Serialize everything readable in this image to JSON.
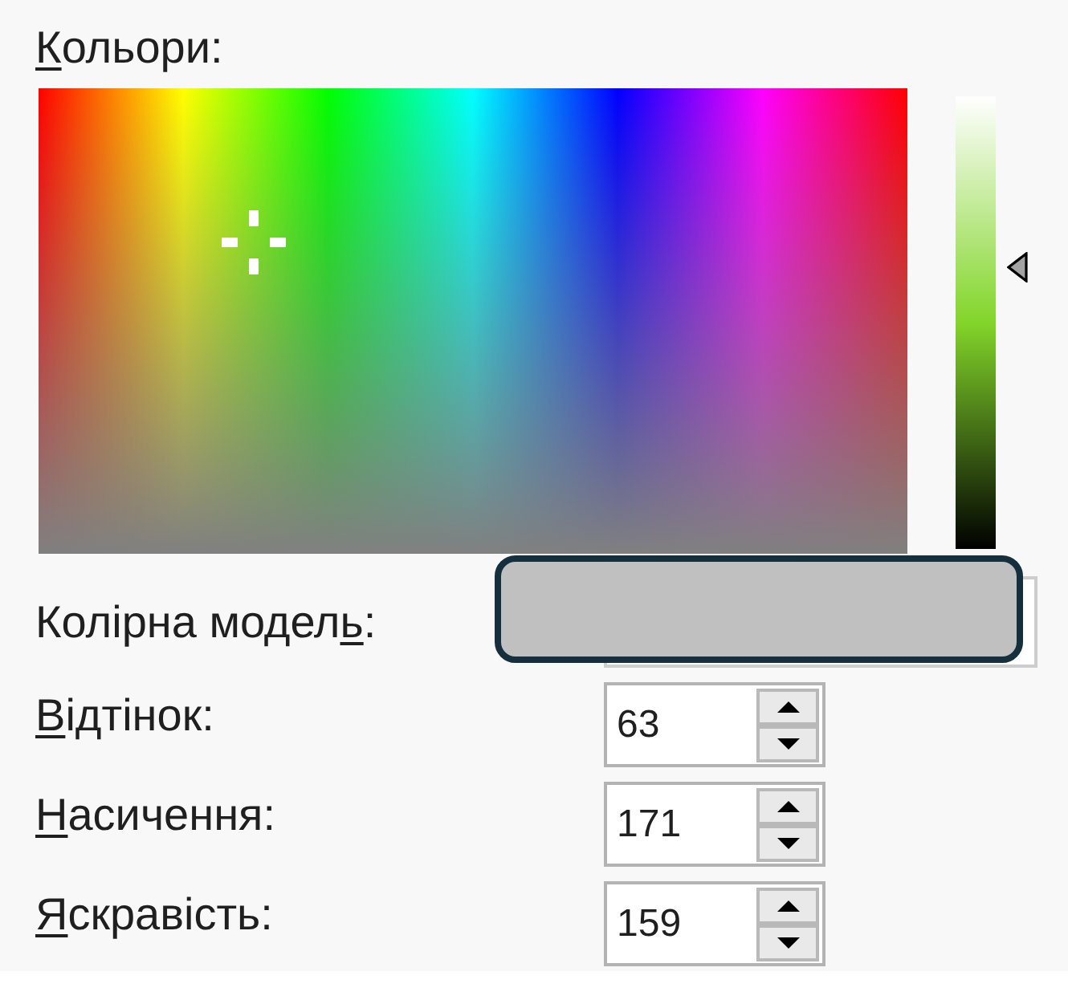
{
  "colors": {
    "label": [
      {
        "text": "К",
        "underlined": true
      },
      {
        "text": "ольори:",
        "underlined": false
      }
    ]
  },
  "color_model": {
    "label": [
      {
        "text": "Колірна модел",
        "underlined": false
      },
      {
        "text": "ь",
        "underlined": true
      },
      {
        "text": ":",
        "underlined": false
      }
    ]
  },
  "fields": [
    {
      "label": [
        {
          "text": "В",
          "underlined": true
        },
        {
          "text": "ідтінок:",
          "underlined": false
        }
      ],
      "value": "63"
    },
    {
      "label": [
        {
          "text": "Н",
          "underlined": true
        },
        {
          "text": "асичення:",
          "underlined": false
        }
      ],
      "value": "171"
    },
    {
      "label": [
        {
          "text": "Я",
          "underlined": true
        },
        {
          "text": "скравість:",
          "underlined": false
        }
      ],
      "value": "159"
    }
  ]
}
